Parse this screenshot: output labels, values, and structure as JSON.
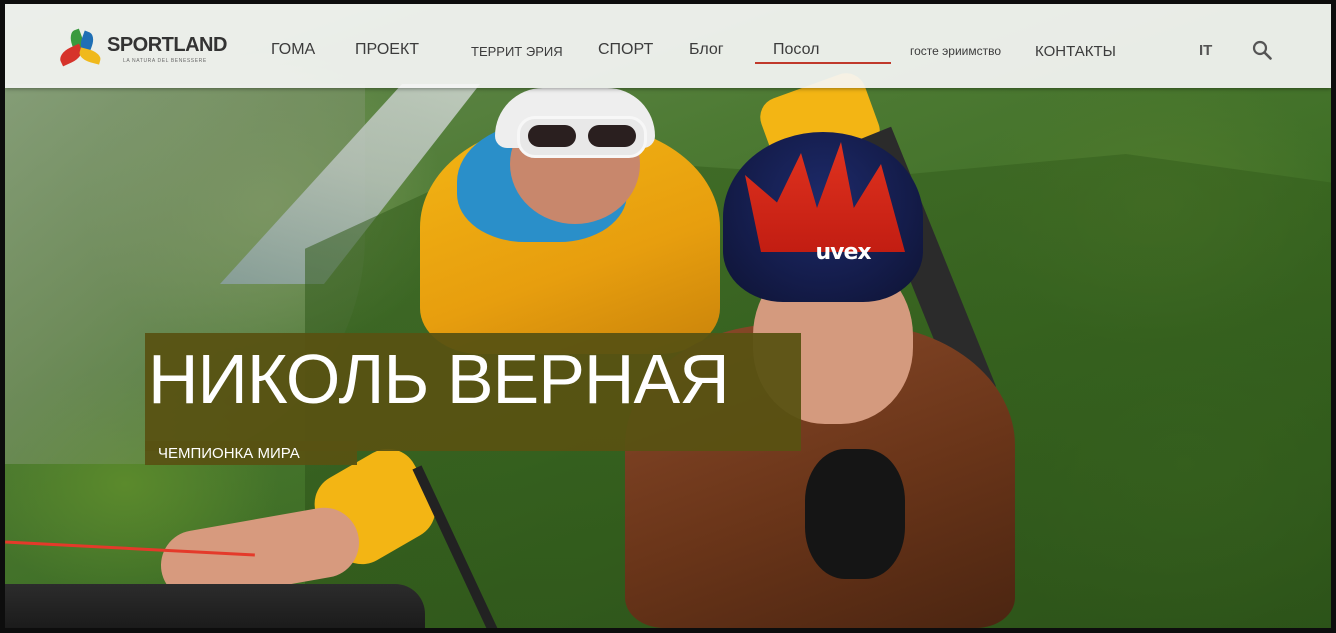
{
  "brand": {
    "name": "SPORTLAND",
    "tagline": "LA NATURA DEL BENESSERE",
    "colors": {
      "green": "#3a9a3e",
      "blue": "#1f6fb5",
      "red": "#d6332b",
      "yellow": "#f0b91c"
    }
  },
  "nav": {
    "items": [
      {
        "label": "ГОМА"
      },
      {
        "label": "ПРОЕКТ"
      },
      {
        "label": "ТЕРРИТ ЭРИЯ"
      },
      {
        "label": "СПОРТ"
      },
      {
        "label": "Блог"
      },
      {
        "label": "Посол",
        "active": true
      },
      {
        "label": "госте эриимство"
      },
      {
        "label": "КОНТАКТЫ"
      }
    ],
    "active_underline_color": "#c0392b",
    "language": "IT",
    "search_icon": "search-icon"
  },
  "hero": {
    "title": "НИКОЛЬ ВЕРНАЯ",
    "subtitle": "ЧЕМПИОНКА МИРА",
    "title_bg_color": "#585212",
    "helmet_brand": "uvex"
  }
}
